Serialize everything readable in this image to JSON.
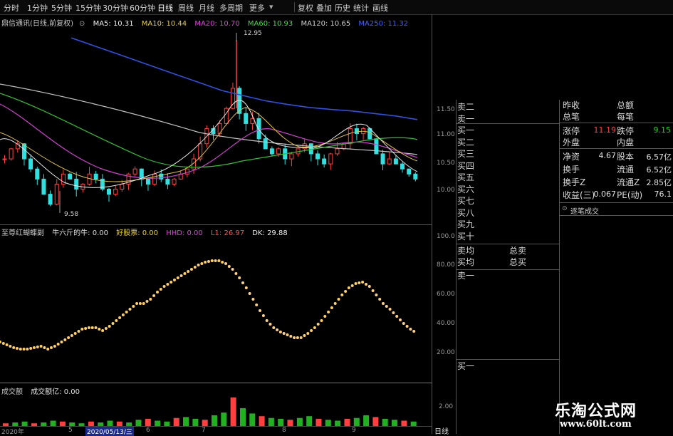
{
  "toolbar": {
    "items": [
      "分时",
      "1分钟",
      "5分钟",
      "15分钟",
      "30分钟",
      "60分钟",
      "日线",
      "周线",
      "月线",
      "多周期",
      "更多"
    ],
    "right_items": [
      "复权",
      "叠加",
      "历史",
      "统计",
      "画线"
    ]
  },
  "main_legend": {
    "stock": "鼎信通讯(日线,前复权)",
    "ma5": "MA5: 10.31",
    "ma10": "MA10: 10.44",
    "ma20": "MA20: 10.70",
    "ma60": "MA60: 10.93",
    "ma120": "MA120: 10.65",
    "ma250": "MA250: 11.32"
  },
  "price_high": "12.95",
  "price_low": "9.58",
  "price_axis": [
    "11.50",
    "11.00",
    "10.50",
    "10.00"
  ],
  "sub_legend": {
    "name": "至尊红蝴蝶副",
    "a": "牛六斤的牛: 0.00",
    "b": "好股票: 0.00",
    "c": "HHD: 0.00",
    "d": "L1: 26.97",
    "e": "DK: 29.88"
  },
  "sub_axis": [
    "100.0",
    "80.00",
    "60.00",
    "40.00",
    "20.00"
  ],
  "vol_legend": {
    "name": "成交额",
    "val": "成交额亿: 0.00"
  },
  "vol_axis": "2.00",
  "date_axis": [
    "2020年",
    "5",
    "2020/05/13/三",
    "6",
    "7",
    "8",
    "9"
  ],
  "period_label": "日线",
  "sell_levels": [
    "卖二",
    "卖一",
    "买一",
    "买二",
    "买三",
    "买四",
    "买五",
    "买六",
    "买七",
    "买八",
    "买九",
    "买十"
  ],
  "ob_extra": {
    "avg_sell": "卖均",
    "avg_buy": "买均",
    "total_sell": "总卖",
    "total_buy": "总买",
    "sell1": "卖一",
    "buy1": "买一"
  },
  "quote": {
    "h1": "昨收",
    "h1b": "总额",
    "h2": "总笔",
    "h2b": "每笔",
    "limit_up_label": "涨停",
    "limit_up": "11.19",
    "limit_down_label": "跌停",
    "limit_down": "9.15",
    "outer_label": "外盘",
    "inner_label": "内盘",
    "nav_label": "净资",
    "nav": "4.67",
    "shares_label": "股本",
    "shares": "6.57亿",
    "turnover_label": "换手",
    "float_label": "流通",
    "float": "6.52亿",
    "turnover_z_label": "换手Z",
    "float_z_label": "流通Z",
    "float_z": "2.85亿",
    "eps_label": "收益(三)",
    "eps": "0.067",
    "pe_label": "PE(动)",
    "pe": "76.1",
    "ticks_title": "逐笔成交"
  },
  "watermark": {
    "cn": "乐淘公式网",
    "url": "www.60lt.com"
  },
  "chart_data": {
    "type": "line",
    "price_range": [
      9.4,
      13.1
    ],
    "ma250": [
      13.0,
      12.85,
      12.7,
      12.55,
      12.4,
      12.25,
      12.1,
      11.95,
      11.85,
      11.75,
      11.68,
      11.62,
      11.58,
      11.55,
      11.5,
      11.45,
      11.38
    ],
    "oscillator_range": [
      0,
      100
    ],
    "oscillator": [
      25,
      23,
      21,
      20,
      20,
      21,
      22,
      20,
      22,
      25,
      28,
      31,
      34,
      35,
      35,
      33,
      36,
      40,
      44,
      48,
      52,
      52,
      55,
      60,
      64,
      67,
      70,
      73,
      76,
      79,
      81,
      82,
      82,
      80,
      76,
      70,
      63,
      55,
      47,
      40,
      35,
      32,
      30,
      28,
      28,
      31,
      35,
      40,
      46,
      52,
      58,
      63,
      66,
      67,
      64,
      58,
      52,
      48,
      43,
      38,
      34,
      31
    ],
    "volume": [
      0.3,
      0.4,
      0.5,
      0.3,
      0.4,
      0.6,
      0.5,
      0.4,
      0.3,
      0.5,
      0.4,
      0.6,
      0.5,
      0.4,
      0.7,
      0.8,
      0.6,
      0.5,
      0.9,
      1.0,
      0.8,
      0.7,
      1.2,
      1.5,
      3.2,
      2.0,
      1.4,
      1.1,
      0.9,
      0.8,
      0.7,
      0.9,
      1.1,
      0.8,
      0.7,
      0.6,
      0.8,
      0.9,
      1.2,
      1.0,
      0.8,
      0.7,
      0.6,
      0.5
    ]
  }
}
